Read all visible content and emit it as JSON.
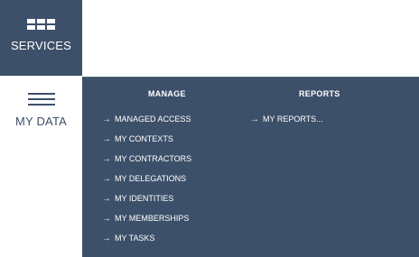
{
  "nav": {
    "services_label": "SERVICES",
    "mydata_label": "MY DATA"
  },
  "mega_menu": {
    "manage": {
      "title": "MANAGE",
      "items": [
        "MANAGED ACCESS",
        "MY CONTEXTS",
        "MY CONTRACTORS",
        "MY DELEGATIONS",
        "MY IDENTITIES",
        "MY MEMBERSHIPS",
        "MY TASKS"
      ]
    },
    "reports": {
      "title": "REPORTS",
      "items": [
        "MY REPORTS..."
      ]
    }
  },
  "colors": {
    "panel": "#3d5069",
    "text_light": "#ffffff"
  },
  "icons": {
    "services": "grid-icon",
    "mydata": "hamburger-menu-icon",
    "link": "arrow-right-icon"
  }
}
